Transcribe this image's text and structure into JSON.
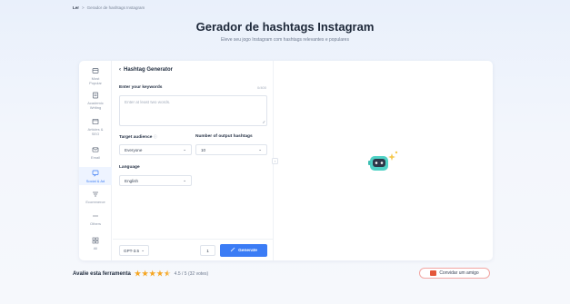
{
  "breadcrumb": {
    "home": "Ler",
    "separator": ">",
    "current": "Gerador de hashtags Instagram"
  },
  "page": {
    "title": "Gerador de hashtags Instagram",
    "subtitle": "Eleve seu jogo Instagram com hashtags relevantes e populares"
  },
  "sidebar": {
    "items": [
      {
        "icon": "box-icon",
        "label1": "Most",
        "label2": "Popular"
      },
      {
        "icon": "document-icon",
        "label1": "Academic",
        "label2": "Writing"
      },
      {
        "icon": "browser-icon",
        "label1": "Articles &",
        "label2": "SEO"
      },
      {
        "icon": "mail-icon",
        "label1": "Email",
        "label2": ""
      },
      {
        "icon": "chat-icon",
        "label1": "Social & Ad",
        "label2": "",
        "active": true
      },
      {
        "icon": "cart-icon",
        "label1": "Ecommerce",
        "label2": ""
      },
      {
        "icon": "dots-icon",
        "label1": "Others",
        "label2": ""
      },
      {
        "icon": "grid-icon",
        "label1": "All",
        "label2": ""
      }
    ]
  },
  "form": {
    "title": "Hashtag Generator",
    "keywords_label": "Enter your keywords",
    "keywords_counter": "0/400",
    "keywords_placeholder": "Enter at least two words.",
    "audience_label": "Target audience",
    "audience_value": "Everyone",
    "output_label": "Number of output hashtags",
    "output_value": "10",
    "language_label": "Language",
    "language_value": "English"
  },
  "footer": {
    "model": "GPT-3.5",
    "quantity": "1",
    "generate_label": "Generate"
  },
  "rating": {
    "label": "Avalie esta ferramenta",
    "stars": 4.5,
    "text": "4.5 / 5 (32 votes)"
  },
  "invite": {
    "label": "Convidar um amigo"
  },
  "colors": {
    "accent": "#3b7cf5",
    "mascot": "#4fd1c5",
    "star": "#f5a623"
  }
}
